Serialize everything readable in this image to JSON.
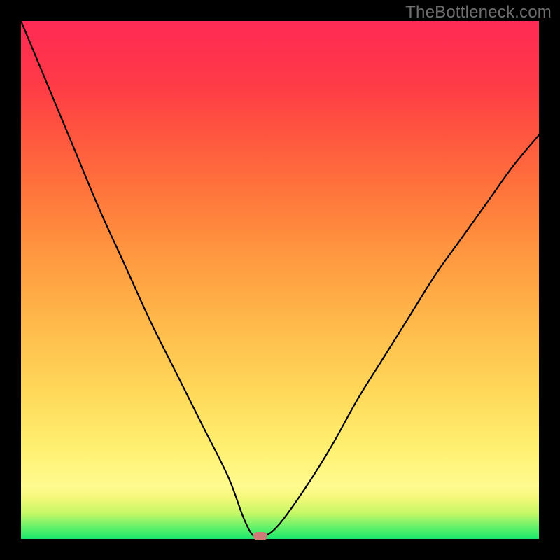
{
  "watermark": "TheBottleneck.com",
  "chart_data": {
    "type": "line",
    "title": "",
    "xlabel": "",
    "ylabel": "",
    "xlim": [
      0,
      100
    ],
    "ylim": [
      0,
      100
    ],
    "grid": false,
    "legend": false,
    "series": [
      {
        "name": "bottleneck-curve",
        "x": [
          0,
          5,
          10,
          15,
          20,
          25,
          30,
          35,
          40,
          43,
          45,
          47,
          50,
          55,
          60,
          65,
          70,
          75,
          80,
          85,
          90,
          95,
          100
        ],
        "y": [
          100,
          88,
          76,
          64,
          53,
          42,
          32,
          22,
          12,
          4,
          0.5,
          0.5,
          3,
          10,
          18,
          27,
          35,
          43,
          51,
          58,
          65,
          72,
          78
        ]
      }
    ],
    "marker": {
      "x": 46.2,
      "y": 0.6,
      "color": "#d07a78"
    },
    "background_gradient": {
      "stops": [
        {
          "pos": 0.0,
          "color": "#19e86b"
        },
        {
          "pos": 0.05,
          "color": "#c7f766"
        },
        {
          "pos": 0.1,
          "color": "#fffb8f"
        },
        {
          "pos": 0.28,
          "color": "#ffd95a"
        },
        {
          "pos": 0.48,
          "color": "#ffa945"
        },
        {
          "pos": 0.68,
          "color": "#ff723c"
        },
        {
          "pos": 0.88,
          "color": "#ff3a47"
        },
        {
          "pos": 1.0,
          "color": "#ff2a55"
        }
      ]
    }
  }
}
